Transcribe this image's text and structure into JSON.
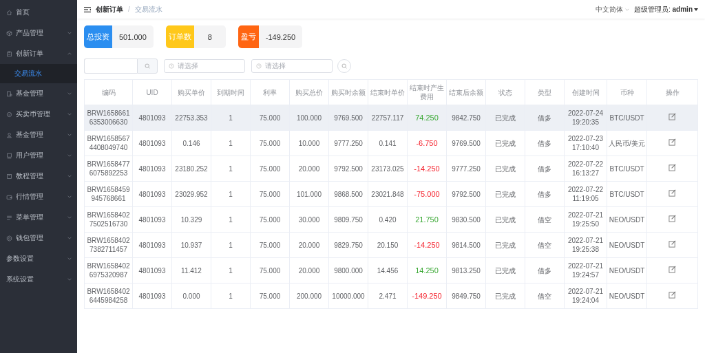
{
  "sidebar": {
    "items": [
      {
        "label": "首页"
      },
      {
        "label": "产品管理",
        "expanded": false
      },
      {
        "label": "创新订单",
        "expanded": true,
        "children": [
          {
            "label": "交易流水",
            "selected": true
          }
        ]
      },
      {
        "label": "基金管理",
        "expanded": false
      },
      {
        "label": "买卖币管理",
        "expanded": false
      },
      {
        "label": "基金管理",
        "expanded": false
      },
      {
        "label": "用户管理",
        "expanded": false
      },
      {
        "label": "教程管理",
        "expanded": false
      },
      {
        "label": "行情管理",
        "expanded": false
      },
      {
        "label": "菜单管理",
        "expanded": false
      },
      {
        "label": "钱包管理",
        "expanded": false
      },
      {
        "label": "参数设置",
        "expanded": false
      },
      {
        "label": "系统设置",
        "expanded": false
      }
    ]
  },
  "breadcrumb": [
    "创新订单",
    "/",
    "交易流水"
  ],
  "header": {
    "language": "中文简体",
    "user_label": "超级管理员:",
    "user_name": "admin"
  },
  "stats": [
    {
      "label": "总投资",
      "value": "501.000",
      "color": "#2b8ef0"
    },
    {
      "label": "订单数",
      "value": "8",
      "color": "#ffc81a"
    },
    {
      "label": "盈亏",
      "value": "-149.250",
      "color": "#ff6512"
    }
  ],
  "filters": {
    "date_placeholders": [
      "请选择",
      "请选择"
    ]
  },
  "table": {
    "columns": [
      "编码",
      "UID",
      "购买单价",
      "到期时间",
      "利率",
      "购买总价",
      "购买时余额",
      "结束时单价",
      "结束时产生费用",
      "结束后余额",
      "状态",
      "类型",
      "创建时间",
      "币种",
      "操作"
    ],
    "rows": [
      {
        "selected": true,
        "cells": [
          "BRW16586616353006630",
          "4801093",
          "22753.353",
          "1",
          "75.000",
          "100.000",
          "9769.500",
          "22757.117"
        ],
        "profit": {
          "text": "74.250",
          "color": "#3aa834"
        },
        "rest": [
          "9842.750",
          "已完成",
          "借多",
          "2022-07-24 19:20:35",
          "BTC/USDT"
        ]
      },
      {
        "selected": false,
        "cells": [
          "BRW16585674408049740",
          "4801093",
          "0.146",
          "1",
          "75.000",
          "10.000",
          "9777.250",
          "0.141"
        ],
        "profit": {
          "text": "-6.750",
          "color": "#f5222d"
        },
        "rest": [
          "9769.500",
          "已完成",
          "借多",
          "2022-07-23 17:10:40",
          "人民币/美元"
        ]
      },
      {
        "selected": false,
        "cells": [
          "BRW16584776075892253",
          "4801093",
          "23180.252",
          "1",
          "75.000",
          "20.000",
          "9792.500",
          "23173.025"
        ],
        "profit": {
          "text": "-14.250",
          "color": "#f5222d"
        },
        "rest": [
          "9777.250",
          "已完成",
          "借多",
          "2022-07-22 16:13:27",
          "BTC/USDT"
        ]
      },
      {
        "selected": false,
        "cells": [
          "BRW1658459945768661",
          "4801093",
          "23029.952",
          "1",
          "75.000",
          "101.000",
          "9868.500",
          "23021.848"
        ],
        "profit": {
          "text": "-75.000",
          "color": "#f5222d"
        },
        "rest": [
          "9792.500",
          "已完成",
          "借多",
          "2022-07-22 11:19:05",
          "BTC/USDT"
        ]
      },
      {
        "selected": false,
        "cells": [
          "BRW16584027502516730",
          "4801093",
          "10.329",
          "1",
          "75.000",
          "30.000",
          "9809.750",
          "0.420"
        ],
        "profit": {
          "text": "21.750",
          "color": "#3aa834"
        },
        "rest": [
          "9830.500",
          "已完成",
          "借空",
          "2022-07-21 19:25:50",
          "NEO/USDT"
        ]
      },
      {
        "selected": false,
        "cells": [
          "BRW16584027382711457",
          "4801093",
          "10.937",
          "1",
          "75.000",
          "20.000",
          "9829.750",
          "20.150"
        ],
        "profit": {
          "text": "-14.250",
          "color": "#f5222d"
        },
        "rest": [
          "9814.500",
          "已完成",
          "借空",
          "2022-07-21 19:25:38",
          "NEO/USDT"
        ]
      },
      {
        "selected": false,
        "cells": [
          "BRW16584026975320987",
          "4801093",
          "11.412",
          "1",
          "75.000",
          "20.000",
          "9800.000",
          "14.456"
        ],
        "profit": {
          "text": "14.250",
          "color": "#3aa834"
        },
        "rest": [
          "9813.250",
          "已完成",
          "借多",
          "2022-07-21 19:24:57",
          "NEO/USDT"
        ]
      },
      {
        "selected": false,
        "cells": [
          "BRW16584026445984258",
          "4801093",
          "0.000",
          "1",
          "75.000",
          "200.000",
          "10000.000",
          "2.471"
        ],
        "profit": {
          "text": "-149.250",
          "color": "#f5222d"
        },
        "rest": [
          "9849.750",
          "已完成",
          "借空",
          "2022-07-21 19:24:04",
          "NEO/USDT"
        ]
      }
    ]
  }
}
